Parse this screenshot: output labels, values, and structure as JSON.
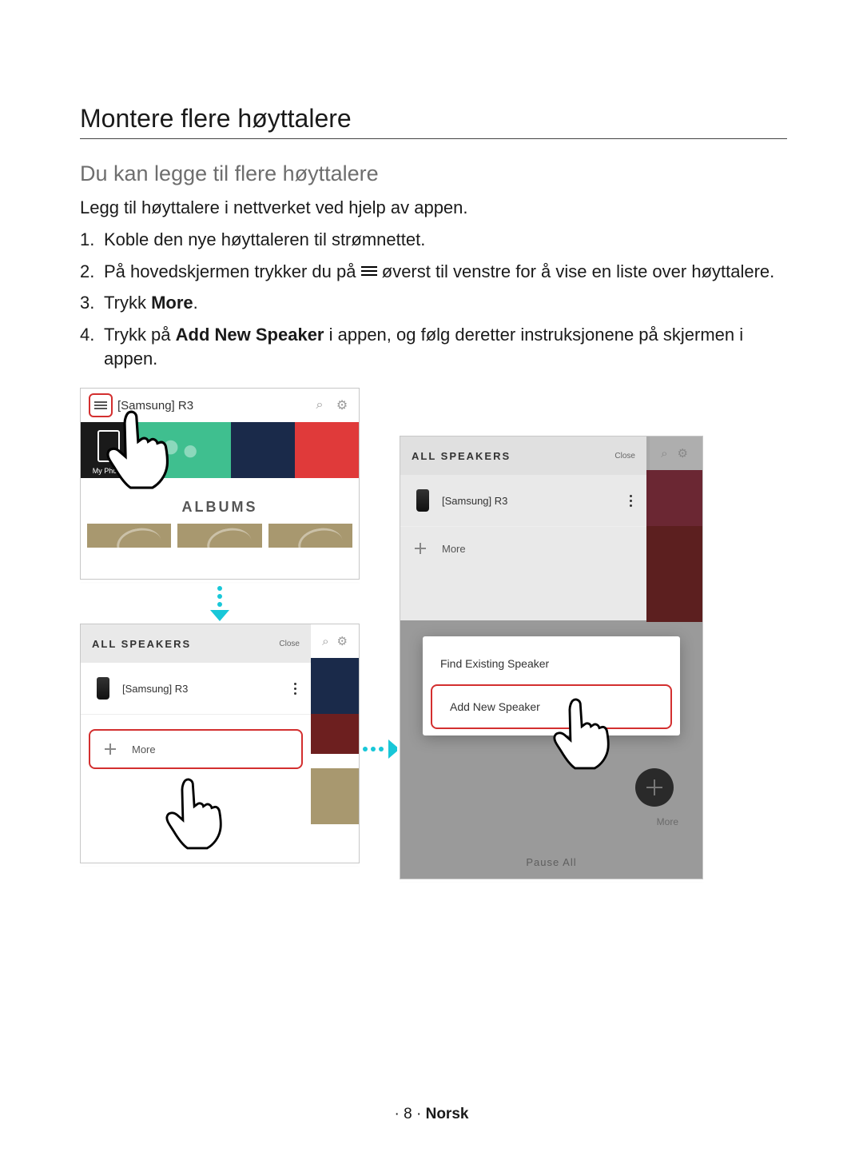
{
  "title": "Montere flere høyttalere",
  "subtitle": "Du kan legge til flere høyttalere",
  "lead": "Legg til høyttalere i nettverket ved hjelp av appen.",
  "steps": {
    "s1": "Koble den nye høyttaleren til strømnettet.",
    "s2a": "På hovedskjermen trykker du på",
    "s2b": "øverst til venstre for å vise en liste over høyttalere.",
    "s3a": "Trykk ",
    "s3b": "More",
    "s3c": ".",
    "s4a": "Trykk på ",
    "s4b": "Add New Speaker",
    "s4c": " i appen, og følg deretter instruksjonene på skjermen i appen."
  },
  "shot1": {
    "device": "[Samsung] R3",
    "my_phone": "My Phone",
    "albums": "ALBUMS"
  },
  "panel": {
    "header": "ALL SPEAKERS",
    "close": "Close",
    "speaker": "[Samsung] R3",
    "more": "More"
  },
  "popup": {
    "find": "Find Existing Speaker",
    "add": "Add New Speaker"
  },
  "shot3": {
    "more_label": "More",
    "pause": "Pause All"
  },
  "footer": {
    "page": "· 8 · ",
    "lang": "Norsk"
  }
}
